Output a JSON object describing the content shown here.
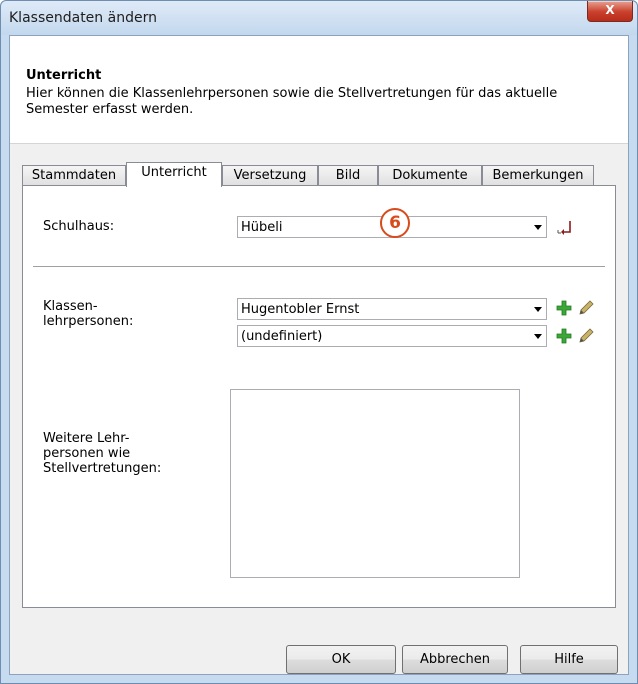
{
  "window": {
    "title": "Klassendaten ändern",
    "close_label": "X"
  },
  "header": {
    "title": "Unterricht",
    "description": "Hier können die Klassenlehrpersonen sowie die Stellvertretungen für das aktuelle Semester erfasst werden."
  },
  "tabs": [
    {
      "label": "Stammdaten"
    },
    {
      "label": "Unterricht"
    },
    {
      "label": "Versetzung"
    },
    {
      "label": "Bild"
    },
    {
      "label": "Dokumente"
    },
    {
      "label": "Bemerkungen"
    }
  ],
  "form": {
    "schulhaus_label": "Schulhaus:",
    "schulhaus_value": "Hübeli",
    "klassen_label_line1": "Klassen-",
    "klassen_label_line2": "lehrpersonen:",
    "lehrperson1_value": "Hugentobler Ernst",
    "lehrperson2_value": "(undefiniert)",
    "weitere_label_line1": "Weitere Lehr-",
    "weitere_label_line2": "personen wie",
    "weitere_label_line3": "Stellvertretungen:"
  },
  "annotation": {
    "badge_number": "6"
  },
  "buttons": {
    "ok": "OK",
    "cancel": "Abbrechen",
    "help": "Hilfe"
  },
  "colors": {
    "accent": "#d84b1a",
    "add_icon": "#3da53a",
    "close": "#c9402c"
  }
}
